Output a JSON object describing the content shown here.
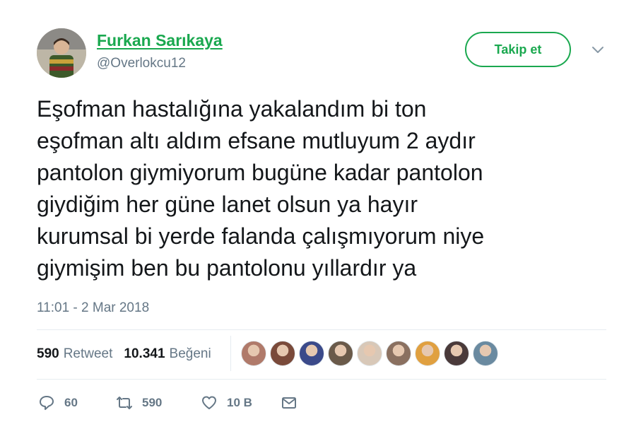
{
  "tweet": {
    "author_name": "Furkan Sarıkaya",
    "handle": "@Overlokcu12",
    "follow_label": "Takip et",
    "text": "Eşofman hastalığına yakalandım bi ton\neşofman altı aldım efsane mutluyum 2 aydır\npantolon giymiyorum bugüne kadar pantolon\ngiydiğim her güne lanet olsun ya hayır\nkurumsal bi yerde falanda çalışmıyorum niye\ngiymişim ben bu pantolonu yıllardır ya",
    "timestamp": "11:01 - 2 Mar 2018"
  },
  "stats": {
    "retweet_count": "590",
    "retweet_label": "Retweet",
    "like_count": "10.341",
    "like_label": "Beğeni"
  },
  "likers": [
    {
      "color": "#b07a6a"
    },
    {
      "color": "#7a4a3a"
    },
    {
      "color": "#3b4a8a"
    },
    {
      "color": "#6a5a4a"
    },
    {
      "color": "#d8c8b8"
    },
    {
      "color": "#8a7060"
    },
    {
      "color": "#e0a040"
    },
    {
      "color": "#4a3a3a"
    },
    {
      "color": "#6a8aa0"
    }
  ],
  "actions": {
    "reply_count": "60",
    "retweet_count": "590",
    "like_count": "10 B"
  },
  "colors": {
    "accent": "#1aa84f",
    "secondary_text": "#657786",
    "primary_text": "#14171a"
  }
}
